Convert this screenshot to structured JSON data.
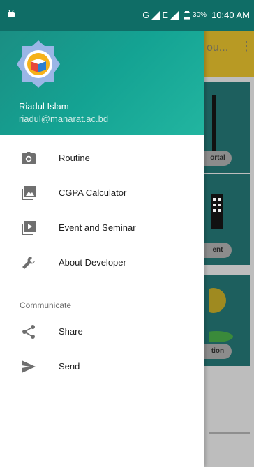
{
  "status_bar": {
    "network_label": "G",
    "network2_label": "E",
    "battery_percent": "30%",
    "time": "10:40 AM"
  },
  "background_app": {
    "title_fragment": "ou...",
    "more_icon": "more-vertical-icon",
    "cards": [
      {
        "label_fragment": "ortal"
      },
      {
        "label_fragment": "ent"
      },
      {
        "label_fragment": "tion"
      }
    ]
  },
  "drawer": {
    "user": {
      "name": "Riadul Islam",
      "email": "riadul@manarat.ac.bd"
    },
    "items": [
      {
        "label": "Routine",
        "icon": "camera-icon"
      },
      {
        "label": "CGPA Calculator",
        "icon": "gallery-icon"
      },
      {
        "label": "Event and Seminar",
        "icon": "slideshow-icon"
      },
      {
        "label": "About Developer",
        "icon": "wrench-icon"
      }
    ],
    "section_title": "Communicate",
    "communicate_items": [
      {
        "label": "Share",
        "icon": "share-icon"
      },
      {
        "label": "Send",
        "icon": "send-icon"
      }
    ]
  },
  "colors": {
    "header_teal": "#14a393",
    "statusbar_teal": "#0f6d66",
    "icon_gray": "#6f6f6f"
  }
}
